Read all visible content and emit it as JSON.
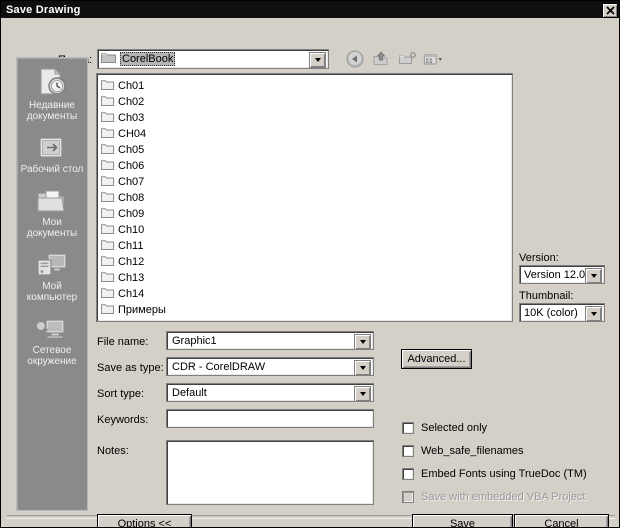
{
  "window": {
    "title": "Save Drawing",
    "close_icon": "close-icon",
    "close_label": "✕"
  },
  "toolbar": {
    "lookin_label": "Папка:",
    "lookin_value": "CorelBook",
    "folder_icon": "folder-icon",
    "dropdown_icon": "chevron-down-icon",
    "buttons": [
      {
        "name": "back-button",
        "icon": "back-arrow-icon"
      },
      {
        "name": "up-one-level-button",
        "icon": "up-folder-icon"
      },
      {
        "name": "create-new-folder-button",
        "icon": "new-folder-icon"
      },
      {
        "name": "views-button",
        "icon": "views-menu-icon"
      }
    ]
  },
  "sidebar": {
    "items": [
      {
        "label": "Недавние документы",
        "icon": "recent-documents-icon",
        "name": "sidebar-item-recent"
      },
      {
        "label": "Рабочий стол",
        "icon": "desktop-icon",
        "name": "sidebar-item-desktop"
      },
      {
        "label": "Мои документы",
        "icon": "my-documents-icon",
        "name": "sidebar-item-my-documents"
      },
      {
        "label": "Мой компьютер",
        "icon": "my-computer-icon",
        "name": "sidebar-item-my-computer"
      },
      {
        "label": "Сетевое окружение",
        "icon": "network-places-icon",
        "name": "sidebar-item-network"
      }
    ]
  },
  "file_list": {
    "items": [
      {
        "name": "Ch01",
        "icon": "folder-icon"
      },
      {
        "name": "Ch02",
        "icon": "folder-icon"
      },
      {
        "name": "Ch03",
        "icon": "folder-icon"
      },
      {
        "name": "CH04",
        "icon": "folder-icon"
      },
      {
        "name": "Ch05",
        "icon": "folder-icon"
      },
      {
        "name": "Ch06",
        "icon": "folder-icon"
      },
      {
        "name": "Ch07",
        "icon": "folder-icon"
      },
      {
        "name": "Ch08",
        "icon": "folder-icon"
      },
      {
        "name": "Ch09",
        "icon": "folder-icon"
      },
      {
        "name": "Ch10",
        "icon": "folder-icon"
      },
      {
        "name": "Ch11",
        "icon": "folder-icon"
      },
      {
        "name": "Ch12",
        "icon": "folder-icon"
      },
      {
        "name": "Ch13",
        "icon": "folder-icon"
      },
      {
        "name": "Ch14",
        "icon": "folder-icon"
      },
      {
        "name": "Примеры",
        "icon": "folder-icon"
      }
    ]
  },
  "options_panel": {
    "version_label": "Version:",
    "version_value": "Version 12.0",
    "thumbnail_label": "Thumbnail:",
    "thumbnail_value": "10K (color)"
  },
  "form": {
    "filename_label": "File name:",
    "filename_value": "Graphic1",
    "savetype_label": "Save as type:",
    "savetype_value": "CDR - CorelDRAW",
    "sorttype_label": "Sort type:",
    "sorttype_value": "Default",
    "keywords_label": "Keywords:",
    "keywords_value": "",
    "keywords_placeholder": "",
    "notes_label": "Notes:",
    "notes_value": "",
    "notes_placeholder": "",
    "advanced_label": "Advanced..."
  },
  "checkboxes": [
    {
      "label": "Selected only",
      "checked": false,
      "disabled": false,
      "name": "checkbox-selected-only"
    },
    {
      "label": "Web_safe_filenames",
      "checked": false,
      "disabled": false,
      "name": "checkbox-web-safe-filenames"
    },
    {
      "label": "Embed Fonts using TrueDoc (TM)",
      "checked": false,
      "disabled": false,
      "name": "checkbox-embed-fonts"
    },
    {
      "label": "Save with embedded VBA Project",
      "checked": false,
      "disabled": true,
      "name": "checkbox-embed-vba"
    }
  ],
  "footer": {
    "options_label": "Options <<",
    "save_label": "Save",
    "cancel_label": "Cancel"
  },
  "colors": {
    "dialog_face": "#d4d0c8",
    "titlebar": "#100f0f",
    "sidebar": "#8a8a8a",
    "field_bg": "#ffffff",
    "disabled_text": "#989898"
  }
}
